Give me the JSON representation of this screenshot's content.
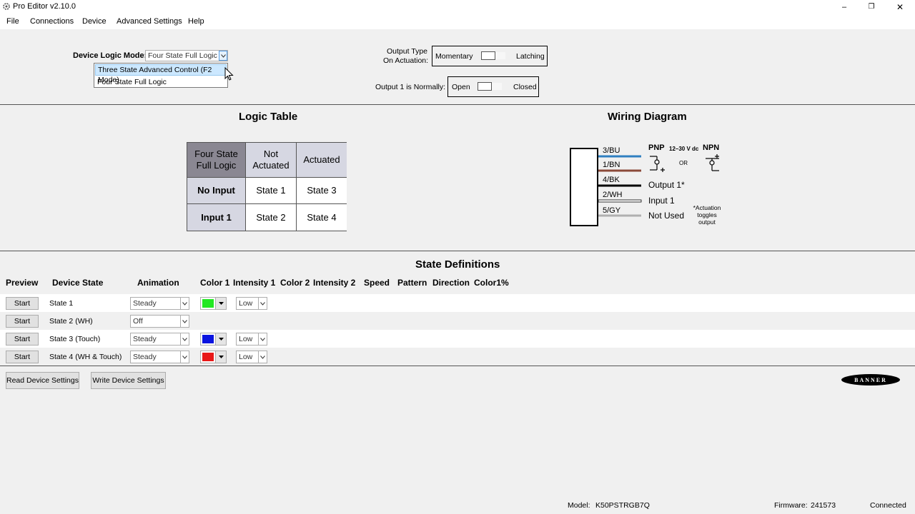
{
  "window": {
    "title": "Pro Editor v2.10.0",
    "controls": {
      "minimize": "–",
      "restore": "❐",
      "close": "✕"
    }
  },
  "menu": [
    "File",
    "Connections",
    "Device",
    "Advanced Settings",
    "Help"
  ],
  "device_logic": {
    "label": "Device Logic Mode:",
    "value": "Four State Full Logic",
    "options": [
      "Three State Advanced Control (F2 Mode)",
      "Four State Full Logic"
    ],
    "highlighted_option": "Three State Advanced Control (F2 Mode)"
  },
  "output_type": {
    "label_line1": "Output Type",
    "label_line2": "On Actuation:",
    "left": "Momentary",
    "right": "Latching"
  },
  "output_normally": {
    "label": "Output 1 is Normally:",
    "left": "Open",
    "right": "Closed"
  },
  "logic_table": {
    "title": "Logic Table",
    "corner_line1": "Four State",
    "corner_line2": "Full Logic",
    "col1_line1": "Not",
    "col1_line2": "Actuated",
    "col2": "Actuated",
    "rows": [
      {
        "header": "No Input",
        "c1": "State 1",
        "c2": "State 3"
      },
      {
        "header": "Input 1",
        "c1": "State 2",
        "c2": "State 4"
      }
    ]
  },
  "wiring": {
    "title": "Wiring Diagram",
    "wires": [
      {
        "label": "3/BU",
        "color": "#2f7fc1"
      },
      {
        "label": "1/BN",
        "color": "#8b4a3a"
      },
      {
        "label": "4/BK",
        "color": "#000000"
      },
      {
        "label": "2/WH",
        "color": "#ffffff"
      },
      {
        "label": "5/GY",
        "color": "#b0b0b0"
      }
    ],
    "pnp": "PNP",
    "voltage": "12–30 V dc",
    "or": "OR",
    "npn": "NPN",
    "output": "Output 1*",
    "input": "Input 1",
    "not_used": "Not Used",
    "note_line1": "*Actuation",
    "note_line2": "toggles",
    "note_line3": "output"
  },
  "state_definitions": {
    "title": "State Definitions",
    "headers": [
      "Preview",
      "Device State",
      "Animation",
      "Color 1",
      "Intensity 1",
      "Color 2",
      "Intensity 2",
      "Speed",
      "Pattern",
      "Direction",
      "Color1%"
    ],
    "rows": [
      {
        "button": "Start",
        "state": "State 1",
        "animation": "Steady",
        "color1": "#22e822",
        "intensity": "Low"
      },
      {
        "button": "Start",
        "state": "State 2 (WH)",
        "animation": "Off",
        "color1": "",
        "intensity": ""
      },
      {
        "button": "Start",
        "state": "State 3 (Touch)",
        "animation": "Steady",
        "color1": "#0a14e0",
        "intensity": "Low"
      },
      {
        "button": "Start",
        "state": "State 4 (WH & Touch)",
        "animation": "Steady",
        "color1": "#e81818",
        "intensity": "Low"
      }
    ]
  },
  "actions": {
    "read": "Read Device Settings",
    "write": "Write Device Settings"
  },
  "brand": "BANNER",
  "status": {
    "model_label": "Model:",
    "model_value": "K50PSTRGB7Q",
    "firmware_label": "Firmware:",
    "firmware_value": "241573",
    "connection": "Connected"
  }
}
